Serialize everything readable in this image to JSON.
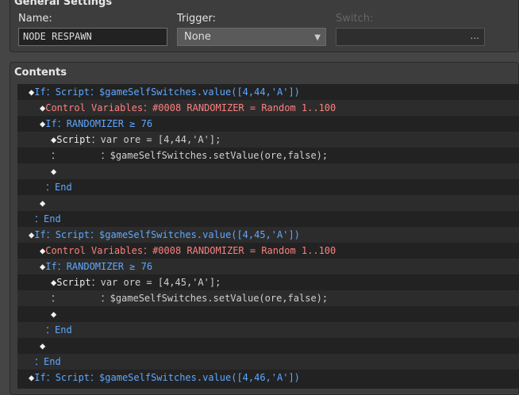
{
  "general": {
    "title": "General Settings",
    "name_label": "Name:",
    "name_value": "NODE RESPAWN",
    "trigger_label": "Trigger:",
    "trigger_value": "None",
    "switch_label": "Switch:",
    "switch_dots": "..."
  },
  "contents": {
    "title": "Contents",
    "rows": [
      {
        "i": 0,
        "segs": [
          {
            "c": "diamond",
            "t": "◆"
          },
          {
            "c": "blue",
            "t": "If："
          },
          {
            "c": "blue",
            "t": "Script："
          },
          {
            "c": "blue",
            "t": "$gameSelfSwitches.value([4,44,'A'])"
          }
        ]
      },
      {
        "i": 1,
        "segs": [
          {
            "c": "diamond",
            "t": "◆"
          },
          {
            "c": "red",
            "t": "Control Variables："
          },
          {
            "c": "red",
            "t": "#0008 RANDOMIZER = Random 1..100"
          }
        ]
      },
      {
        "i": 1,
        "segs": [
          {
            "c": "diamond",
            "t": "◆"
          },
          {
            "c": "blue",
            "t": "If："
          },
          {
            "c": "blue",
            "t": "RANDOMIZER ≥ 76"
          }
        ]
      },
      {
        "i": 2,
        "segs": [
          {
            "c": "diamond",
            "t": "◆"
          },
          {
            "c": "white",
            "t": "Script"
          },
          {
            "c": "gray",
            "t": "：var ore = [4,44,'A'];"
          }
        ]
      },
      {
        "i": 2,
        "segs": [
          {
            "c": "gray",
            "t": "："
          },
          {
            "c": "gray",
            "t": "       ：$gameSelfSwitches.setValue(ore,false);"
          }
        ]
      },
      {
        "i": 2,
        "segs": [
          {
            "c": "diamond",
            "t": "◆"
          }
        ]
      },
      {
        "i": 1.5,
        "segs": [
          {
            "c": "blue",
            "t": "："
          },
          {
            "c": "blue",
            "t": "End"
          }
        ]
      },
      {
        "i": 1,
        "segs": [
          {
            "c": "diamond",
            "t": "◆"
          }
        ]
      },
      {
        "i": 0.5,
        "segs": [
          {
            "c": "blue",
            "t": "："
          },
          {
            "c": "blue",
            "t": "End"
          }
        ]
      },
      {
        "i": 0,
        "segs": [
          {
            "c": "diamond",
            "t": "◆"
          },
          {
            "c": "blue",
            "t": "If："
          },
          {
            "c": "blue",
            "t": "Script："
          },
          {
            "c": "blue",
            "t": "$gameSelfSwitches.value([4,45,'A'])"
          }
        ]
      },
      {
        "i": 1,
        "segs": [
          {
            "c": "diamond",
            "t": "◆"
          },
          {
            "c": "red",
            "t": "Control Variables："
          },
          {
            "c": "red",
            "t": "#0008 RANDOMIZER = Random 1..100"
          }
        ]
      },
      {
        "i": 1,
        "segs": [
          {
            "c": "diamond",
            "t": "◆"
          },
          {
            "c": "blue",
            "t": "If："
          },
          {
            "c": "blue",
            "t": "RANDOMIZER ≥ 76"
          }
        ]
      },
      {
        "i": 2,
        "segs": [
          {
            "c": "diamond",
            "t": "◆"
          },
          {
            "c": "white",
            "t": "Script"
          },
          {
            "c": "gray",
            "t": "：var ore = [4,45,'A'];"
          }
        ]
      },
      {
        "i": 2,
        "segs": [
          {
            "c": "gray",
            "t": "："
          },
          {
            "c": "gray",
            "t": "       ：$gameSelfSwitches.setValue(ore,false);"
          }
        ]
      },
      {
        "i": 2,
        "segs": [
          {
            "c": "diamond",
            "t": "◆"
          }
        ]
      },
      {
        "i": 1.5,
        "segs": [
          {
            "c": "blue",
            "t": "："
          },
          {
            "c": "blue",
            "t": "End"
          }
        ]
      },
      {
        "i": 1,
        "segs": [
          {
            "c": "diamond",
            "t": "◆"
          }
        ]
      },
      {
        "i": 0.5,
        "segs": [
          {
            "c": "blue",
            "t": "："
          },
          {
            "c": "blue",
            "t": "End"
          }
        ]
      },
      {
        "i": 0,
        "segs": [
          {
            "c": "diamond",
            "t": "◆"
          },
          {
            "c": "blue",
            "t": "If："
          },
          {
            "c": "blue",
            "t": "Script："
          },
          {
            "c": "blue",
            "t": "$gameSelfSwitches.value([4,46,'A'])"
          }
        ]
      }
    ]
  }
}
